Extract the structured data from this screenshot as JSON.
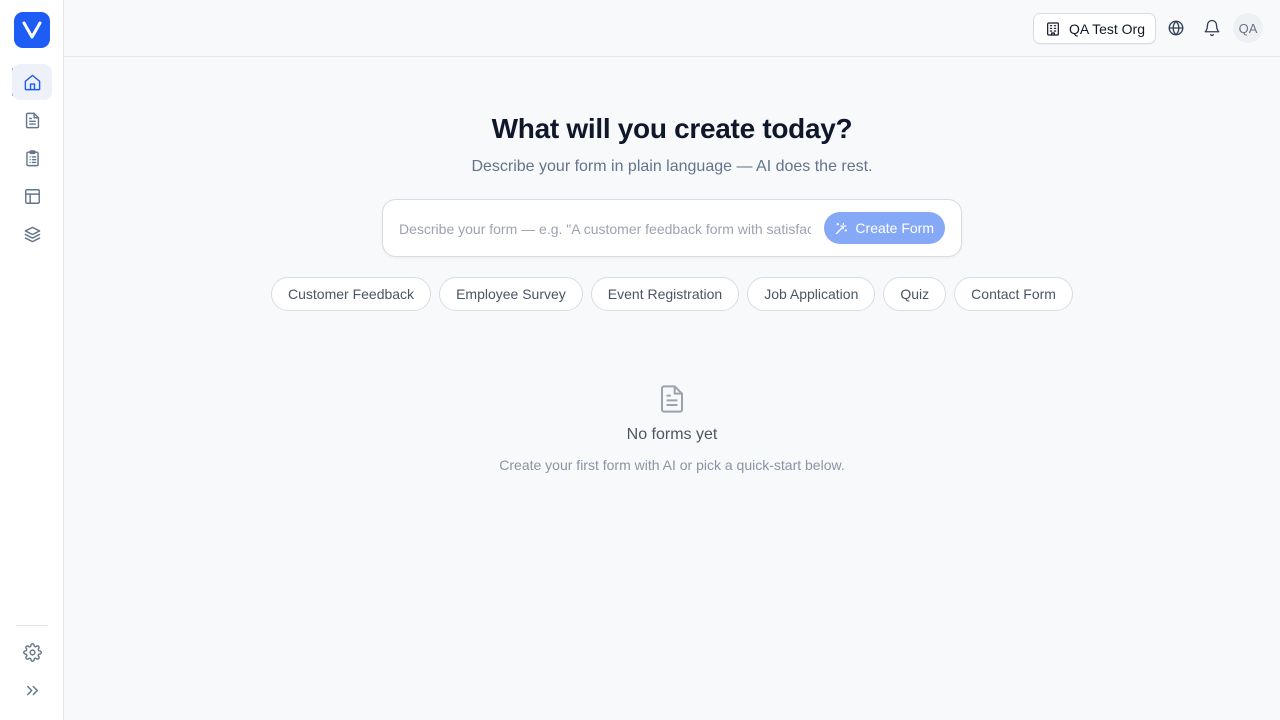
{
  "brand": {
    "logo_letter": "V",
    "accent": "#1d5cf5"
  },
  "sidebar": {
    "items": [
      {
        "icon": "home-icon",
        "active": true
      },
      {
        "icon": "document-icon",
        "active": false
      },
      {
        "icon": "clipboard-list-icon",
        "active": false
      },
      {
        "icon": "layout-icon",
        "active": false
      },
      {
        "icon": "layers-icon",
        "active": false
      }
    ],
    "bottom": [
      {
        "icon": "gear-icon"
      },
      {
        "icon": "chevrons-right-icon"
      }
    ]
  },
  "header": {
    "org_name": "QA Test Org",
    "org_icon": "building-icon",
    "language_icon": "globe-icon",
    "notifications_icon": "bell-icon",
    "avatar_initials": "QA"
  },
  "hero": {
    "title": "What will you create today?",
    "subtitle": "Describe your form in plain language — AI does the rest."
  },
  "prompt": {
    "placeholder": "Describe your form — e.g. \"A customer feedback form with satisfaction rating\"",
    "value": "",
    "button_label": "Create Form",
    "button_icon": "magic-wand-icon"
  },
  "quick_starts": [
    "Customer Feedback",
    "Employee Survey",
    "Event Registration",
    "Job Application",
    "Quiz",
    "Contact Form"
  ],
  "empty_state": {
    "icon": "document-icon",
    "title": "No forms yet",
    "subtitle": "Create your first form with AI or pick a quick-start below."
  }
}
